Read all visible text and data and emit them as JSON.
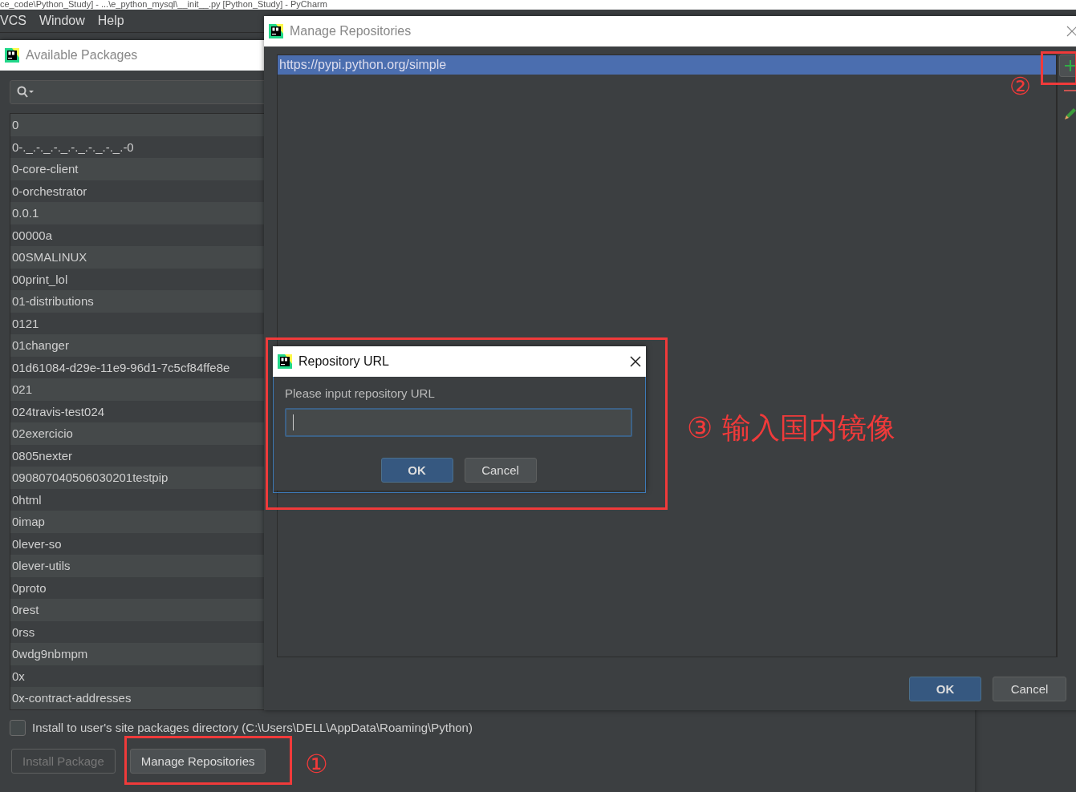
{
  "ide_title": "ce_code\\Python_Study] - ...\\e_python_mysql\\__init__.py [Python_Study] - PyCharm",
  "menu": [
    {
      "label": "VCS"
    },
    {
      "label": "Window"
    },
    {
      "label": "Help"
    }
  ],
  "packages_window": {
    "title": "Available Packages",
    "packages": [
      "0",
      "0-._.-._.-._.-._.-._.-._.-0",
      "0-core-client",
      "0-orchestrator",
      "0.0.1",
      "00000a",
      "00SMALINUX",
      "00print_lol",
      "01-distributions",
      "0121",
      "01changer",
      "01d61084-d29e-11e9-96d1-7c5cf84ffe8e",
      "021",
      "024travis-test024",
      "02exercicio",
      "0805nexter",
      "090807040506030201testpip",
      "0html",
      "0imap",
      "0lever-so",
      "0lever-utils",
      "0proto",
      "0rest",
      "0rss",
      "0wdg9nbmpm",
      "0x",
      "0x-contract-addresses"
    ],
    "user_site_checkbox": {
      "label": "Install to user's site packages directory (C:\\Users\\DELL\\AppData\\Roaming\\Python)",
      "checked": false
    },
    "buttons": [
      {
        "label": "Install Package",
        "disabled": true
      },
      {
        "label": "Manage Repositories",
        "disabled": false
      }
    ]
  },
  "repos_window": {
    "title": "Manage Repositories",
    "repositories": [
      {
        "url": "https://pypi.python.org/simple",
        "selected": true
      }
    ],
    "buttons": [
      {
        "label": "OK",
        "primary": true
      },
      {
        "label": "Cancel",
        "primary": false
      }
    ]
  },
  "url_dialog": {
    "title": "Repository URL",
    "prompt": "Please input repository URL",
    "buttons": [
      {
        "label": "OK",
        "primary": true
      },
      {
        "label": "Cancel",
        "primary": false
      }
    ]
  },
  "annotations": [
    {
      "label": "①"
    },
    {
      "label": "②"
    },
    {
      "label": "③ 输入国内镜像"
    }
  ]
}
